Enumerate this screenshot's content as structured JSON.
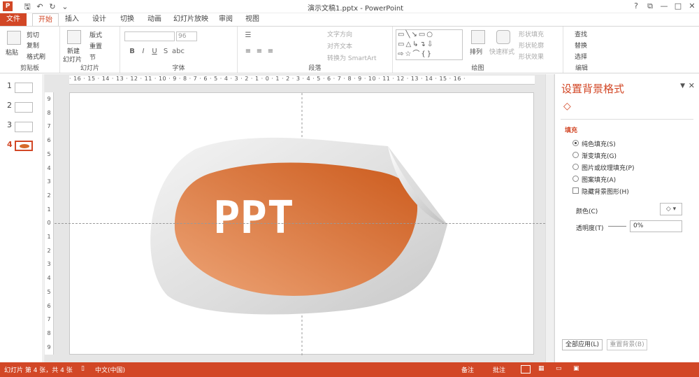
{
  "titlebar": {
    "app_icon": "P",
    "doc_title": "演示文稿1.pptx - PowerPoint",
    "qat": [
      "save-icon",
      "undo-icon",
      "redo-icon",
      "customize-icon"
    ],
    "controls": [
      "?",
      "⧉",
      "—",
      "□",
      "✕"
    ]
  },
  "tabs": [
    "文件",
    "开始",
    "插入",
    "设计",
    "切换",
    "动画",
    "幻灯片放映",
    "审阅",
    "视图"
  ],
  "ribbon": {
    "clipboard": {
      "label": "剪贴板",
      "paste": "粘贴",
      "cut": "剪切",
      "copy": "复制",
      "painter": "格式刷"
    },
    "slides": {
      "label": "幻灯片",
      "new": "新建",
      "new2": "幻灯片",
      "layout": "版式",
      "reset": "重置",
      "section": "节"
    },
    "font": {
      "label": "字体",
      "size": "96"
    },
    "paragraph": {
      "label": "段落",
      "dir": "文字方向",
      "align": "对齐文本",
      "smartart": "转换为 SmartArt"
    },
    "drawing": {
      "label": "绘图",
      "arrange": "排列",
      "quick": "快速样式",
      "fill": "形状填充",
      "outline": "形状轮廓",
      "effect": "形状效果"
    },
    "editing": {
      "label": "编辑",
      "find": "查找",
      "replace": "替换",
      "select": "选择"
    }
  },
  "thumbnails": [
    {
      "n": "1"
    },
    {
      "n": "2"
    },
    {
      "n": "3"
    },
    {
      "n": "4",
      "active": true
    }
  ],
  "slide": {
    "text": "PPT",
    "accent": "#d76a2a",
    "accent_light": "#eba574"
  },
  "ruler": {
    "h": "· 16 · 15 · 14 · 13 · 12 · 11 · 10 · 9 · 8 · 7 · 6 · 5 · 4 · 3 · 2 · 1 · 0 · 1 · 2 · 3 · 4 · 5 · 6 · 7 · 8 · 9 · 10 · 11 · 12 · 13 · 14 · 15 · 16 ·",
    "v": [
      "9",
      "8",
      "7",
      "6",
      "5",
      "4",
      "3",
      "2",
      "1",
      "0",
      "1",
      "2",
      "3",
      "4",
      "5",
      "6",
      "7",
      "8",
      "9"
    ]
  },
  "pane": {
    "title": "设置背景格式",
    "section": "填充",
    "options": [
      {
        "label": "纯色填充(S)",
        "on": true
      },
      {
        "label": "渐变填充(G)",
        "on": false
      },
      {
        "label": "图片或纹理填充(P)",
        "on": false
      },
      {
        "label": "图案填充(A)",
        "on": false
      }
    ],
    "hide_bg": "隐藏背景图形(H)",
    "color_label": "颜色(C)",
    "transparency_label": "透明度(T)",
    "transparency_value": "0%",
    "apply_all": "全部应用(L)",
    "reset_bg": "重置背景(B)"
  },
  "status": {
    "slide": "幻灯片 第 4 张，共 4 张",
    "lang": "中文(中国)",
    "notes": "备注",
    "comments": "批注"
  },
  "colors": {
    "brand": "#d24726"
  }
}
